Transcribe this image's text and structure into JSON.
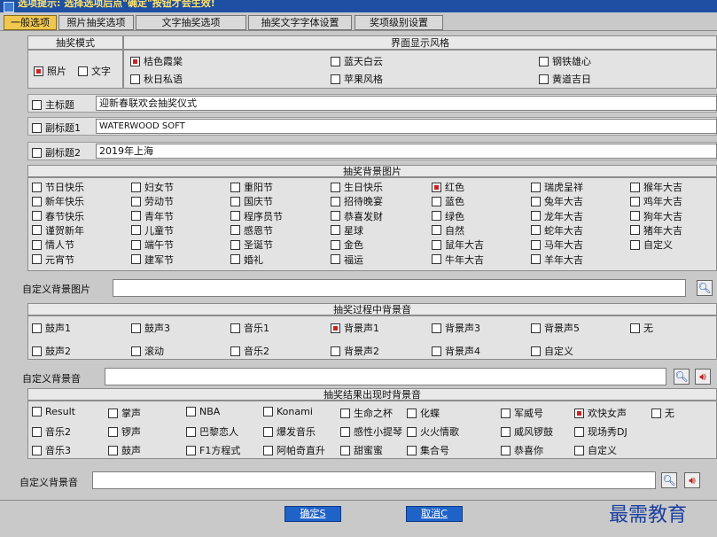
{
  "window": {
    "title": "选项提示: 选择选项后点\"确定\"按钮才会生效!"
  },
  "tabs": [
    "一般选项",
    "照片抽奖选项",
    "文字抽奖选项",
    "抽奖文字字体设置",
    "奖项级别设置"
  ],
  "mode": {
    "header": "抽奖模式",
    "photo": "照片",
    "text": "文字"
  },
  "style": {
    "header": "界面显示风格",
    "items": [
      "桔色霞棠",
      "秋日私语",
      "蓝天白云",
      "苹果风格",
      "钢铁雄心",
      "黄道吉日"
    ]
  },
  "titles": {
    "main_label": "主标题",
    "main_value": "迎新春联欢会抽奖仪式",
    "sub1_label": "副标题1",
    "sub1_value": "WATERWOOD SOFT",
    "sub2_label": "副标题2",
    "sub2_value": "2019年上海"
  },
  "bg_images": {
    "header": "抽奖背景图片",
    "col1": [
      "节日快乐",
      "新年快乐",
      "春节快乐",
      "谨贺新年",
      "情人节",
      "元宵节"
    ],
    "col2": [
      "妇女节",
      "劳动节",
      "青年节",
      "儿童节",
      "端午节",
      "建军节"
    ],
    "col3": [
      "重阳节",
      "国庆节",
      "程序员节",
      "感恩节",
      "圣诞节",
      "婚礼"
    ],
    "col4": [
      "生日快乐",
      "招待晚宴",
      "恭喜发财",
      "星球",
      "金色",
      "福运"
    ],
    "col5": [
      "红色",
      "蓝色",
      "绿色",
      "自然",
      "鼠年大吉",
      "牛年大吉"
    ],
    "col6": [
      "瑞虎呈祥",
      "兔年大吉",
      "龙年大吉",
      "蛇年大吉",
      "马年大吉",
      "羊年大吉"
    ],
    "col7": [
      "猴年大吉",
      "鸡年大吉",
      "狗年大吉",
      "猪年大吉",
      "自定义"
    ],
    "custom_label": "自定义背景图片"
  },
  "process_sound": {
    "header": "抽奖过程中背景音",
    "row1": [
      "鼓声1",
      "鼓声3",
      "音乐1",
      "背景声1",
      "背景声3",
      "背景声5",
      "无"
    ],
    "row2": [
      "鼓声2",
      "滚动",
      "音乐2",
      "背景声2",
      "背景声4",
      "自定义"
    ],
    "custom_label": "自定义背景音"
  },
  "result_sound": {
    "header": "抽奖结果出现时背景音",
    "row1": [
      "Result",
      "掌声",
      "NBA",
      "Konami",
      "生命之杯",
      "化蝶",
      "军威号",
      "欢快女声",
      "无"
    ],
    "row2": [
      "音乐2",
      "锣声",
      "巴黎恋人",
      "爆发音乐",
      "感性小提琴",
      "火火情歌",
      "威风锣鼓",
      "现场秀DJ"
    ],
    "row3": [
      "音乐3",
      "鼓声",
      "F1方程式",
      "阿帕奇直升",
      "甜蜜蜜",
      "集合号",
      "恭喜你",
      "自定义"
    ],
    "custom_label": "自定义背景音"
  },
  "buttons": {
    "ok": "确定S",
    "cancel": "取消C"
  },
  "watermark": "最需教育",
  "colors": {
    "accent": "#1f63c9",
    "active_tab": "#f0c850",
    "checked": "#cc2222"
  }
}
